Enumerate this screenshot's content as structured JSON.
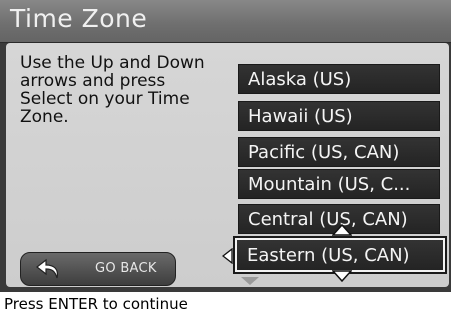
{
  "title": "Time Zone",
  "instructions": "Use the Up and Down arrows and press Select on your Time Zone.",
  "zones": [
    "Alaska (US)",
    "Hawaii (US)",
    "Pacific (US, CAN)",
    "Mountain (US, C...",
    "Central (US, CAN)",
    "Eastern (US, CAN)"
  ],
  "selected_zone": "Eastern (US, CAN)",
  "go_back_label": "GO BACK",
  "status": "Press ENTER to continue",
  "icons": [
    "back-arrow-icon",
    "scroll-up-arrow-icon",
    "scroll-down-arrow-icon",
    "left-arrow-icon"
  ]
}
